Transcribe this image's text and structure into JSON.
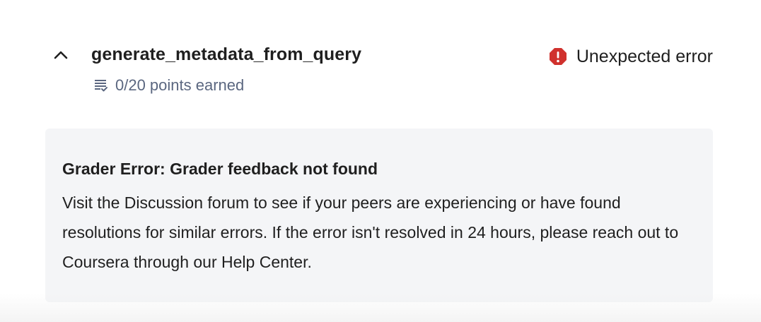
{
  "item": {
    "title": "generate_metadata_from_query",
    "points": "0/20 points earned",
    "status": "Unexpected error",
    "icons": {
      "toggle": "chevron-up-icon",
      "points": "assignment-checklist-icon",
      "status": "error-octagon-icon"
    },
    "colors": {
      "error": "#d0312d",
      "muted": "#5b6780"
    }
  },
  "feedback": {
    "title": "Grader Error: Grader feedback not found",
    "body": "Visit the Discussion forum to see if your peers are experiencing or have found resolutions for similar errors. If the error isn't resolved in 24 hours, please reach out to Coursera through our Help Center."
  }
}
